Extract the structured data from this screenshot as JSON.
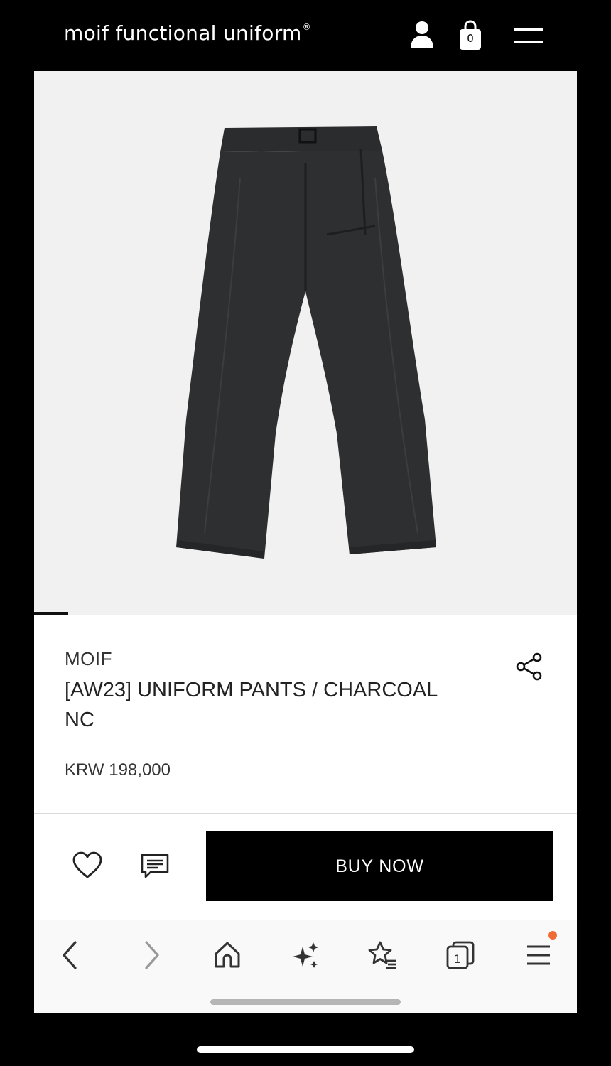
{
  "header": {
    "brand": "moif functional uniform",
    "registered_mark": "®",
    "cart_count": "0",
    "icons": [
      "user-icon",
      "shopping-bag-icon",
      "hamburger-menu-icon"
    ]
  },
  "gallery": {
    "image_alt": "charcoal pants"
  },
  "product": {
    "brand": "MOIF",
    "title": "[AW23] UNIFORM PANTS / CHARCOAL NC",
    "price": "KRW 198,000"
  },
  "actions": {
    "buy_label": "BUY NOW",
    "icons": [
      "heart-icon",
      "review-icon",
      "share-icon"
    ]
  },
  "browser_toolbar": {
    "tab_count": "1",
    "items": [
      "back-icon",
      "forward-icon",
      "home-icon",
      "sparkles-icon",
      "bookmarks-icon",
      "tabs-icon",
      "menu-icon"
    ],
    "notification_color": "#f06a35"
  },
  "colors": {
    "background": "#000000",
    "panel": "#ffffff",
    "gallery": "#f1f1f1",
    "accent": "#000000"
  }
}
